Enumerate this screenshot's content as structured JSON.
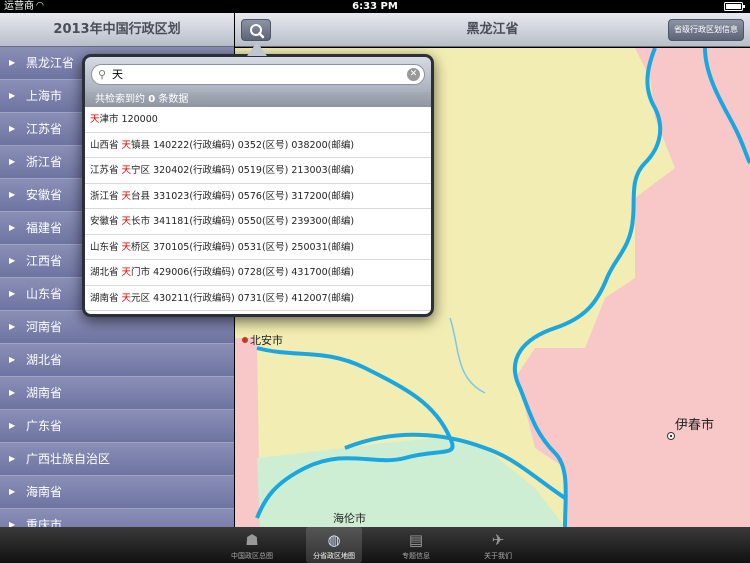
{
  "status_bar": {
    "carrier": "运营商",
    "time": "6:33 PM"
  },
  "master": {
    "title": "2013年中国行政区划",
    "provinces": [
      "黑龙江省",
      "上海市",
      "江苏省",
      "浙江省",
      "安徽省",
      "福建省",
      "江西省",
      "山东省",
      "河南省",
      "湖北省",
      "湖南省",
      "广东省",
      "广西壮族自治区",
      "海南省",
      "重庆市"
    ]
  },
  "detail": {
    "title": "黑龙江省",
    "info_button": "省级行政区划信息"
  },
  "map": {
    "labels": {
      "beian": "北安市",
      "yichun": "伊春市",
      "hailun": "海伦市"
    },
    "colors": {
      "yellow": "#f2edb2",
      "pink": "#f8c8c8",
      "green": "#cdeed2",
      "river": "#1aa7e0"
    }
  },
  "search": {
    "query": "天",
    "count_prefix": "共检索到约",
    "count_value": "0",
    "count_suffix": "条数据",
    "results": [
      {
        "pre": "",
        "hl": "天",
        "post": "津市 120000"
      },
      {
        "pre": "山西省 ",
        "hl": "天",
        "post": "镇县 140222(行政编码) 0352(区号) 038200(邮编)"
      },
      {
        "pre": "江苏省 ",
        "hl": "天",
        "post": "宁区 320402(行政编码) 0519(区号) 213003(邮编)"
      },
      {
        "pre": "浙江省 ",
        "hl": "天",
        "post": "台县 331023(行政编码) 0576(区号) 317200(邮编)"
      },
      {
        "pre": "安徽省 ",
        "hl": "天",
        "post": "长市 341181(行政编码) 0550(区号) 239300(邮编)"
      },
      {
        "pre": "山东省 ",
        "hl": "天",
        "post": "桥区 370105(行政编码) 0531(区号) 250031(邮编)"
      },
      {
        "pre": "湖北省 ",
        "hl": "天",
        "post": "门市 429006(行政编码) 0728(区号) 431700(邮编)"
      },
      {
        "pre": "湖南省 ",
        "hl": "天",
        "post": "元区 430211(行政编码) 0731(区号) 412007(邮编)"
      }
    ]
  },
  "tabs": [
    {
      "label": "中国政区总图",
      "icon": "china-map-icon",
      "active": false
    },
    {
      "label": "分省政区地图",
      "icon": "globe-icon",
      "active": true
    },
    {
      "label": "专题信息",
      "icon": "document-icon",
      "active": false
    },
    {
      "label": "关于我们",
      "icon": "bird-icon",
      "active": false
    }
  ]
}
